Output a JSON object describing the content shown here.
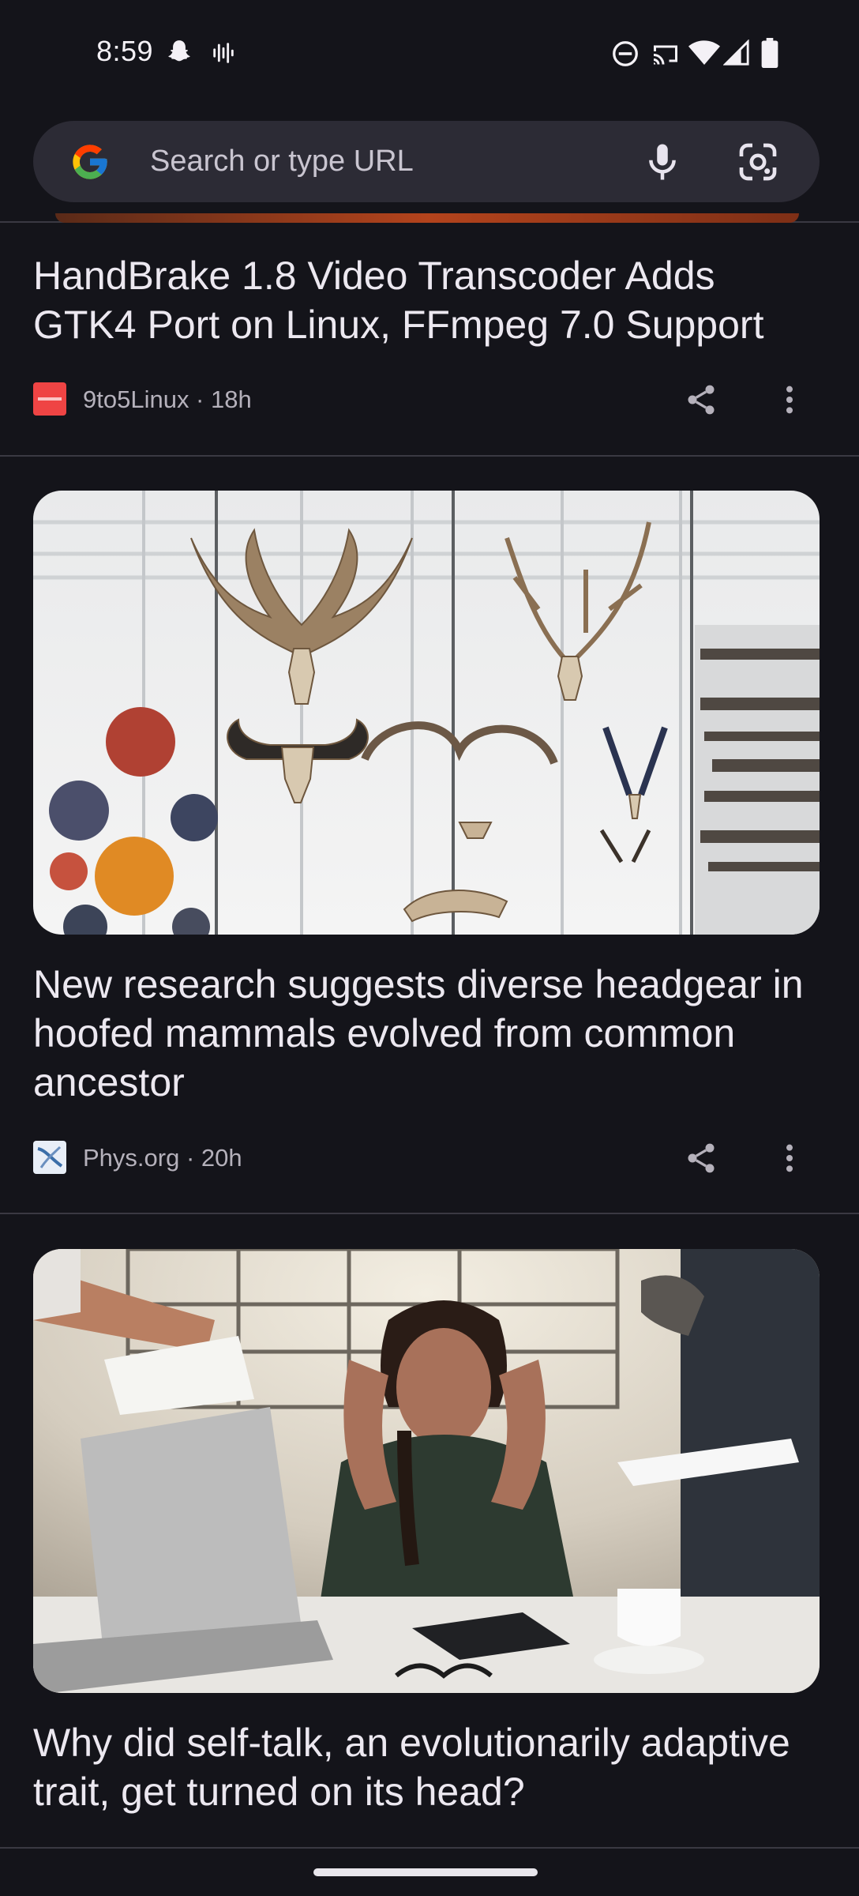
{
  "status_bar": {
    "time": "8:59",
    "icons": [
      "snapchat-icon",
      "audio-wave-icon",
      "dnd-icon",
      "cast-icon",
      "wifi-icon",
      "signal-icon",
      "battery-icon"
    ]
  },
  "omnibox": {
    "placeholder": "Search or type URL",
    "icons": [
      "google-g-icon",
      "mic-icon",
      "lens-icon"
    ]
  },
  "articles": [
    {
      "title": "HandBrake 1.8 Video Transcoder Adds GTK4 Port on Linux, FFmpeg 7.0 Support",
      "source": "9to5Linux",
      "age": "18h",
      "meta": "9to5Linux · 18h",
      "favicon_color": "#ef4444"
    },
    {
      "title": "New research suggests diverse headgear in hoofed mammals evolved from common ancestor",
      "source": "Phys.org",
      "age": "20h",
      "meta": "Phys.org · 20h",
      "image": "museum-antlers-horns-display"
    },
    {
      "title": "Why did self-talk, an evolutionarily adaptive trait, get turned on its head?",
      "image": "stressed-woman-at-desk-with-laptop"
    }
  ],
  "colors": {
    "background": "#14141a",
    "omnibox": "#2c2b35",
    "text_primary": "#ece8f0",
    "text_secondary": "#b5b1bb",
    "divider": "#3a3942"
  }
}
